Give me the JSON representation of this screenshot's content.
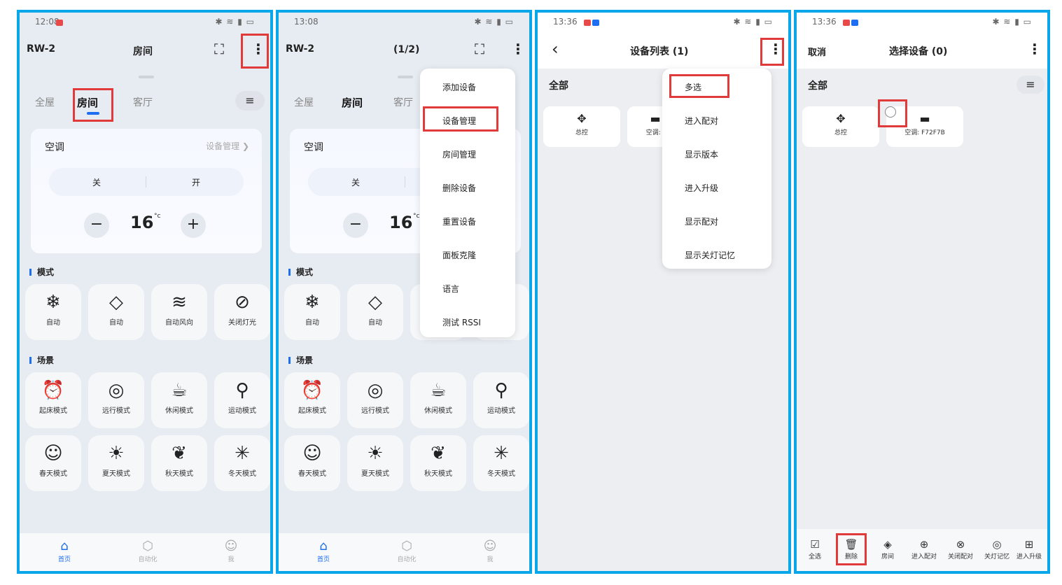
{
  "p1": {
    "status_time": "12:08",
    "status_right": "✱ ≋ ▮ ▭",
    "device": "RW-2",
    "title": "房间",
    "tabs": [
      "全屋",
      "房间",
      "客厅"
    ],
    "card": {
      "name": "空调",
      "link": "设备管理",
      "off": "关",
      "on": "开",
      "temp": "16",
      "unit": "°c"
    },
    "section_mode": "模式",
    "modes": [
      {
        "icon": "❄",
        "label": "自动"
      },
      {
        "icon": "◇",
        "label": "自动"
      },
      {
        "icon": "≋",
        "label": "自动风向"
      },
      {
        "icon": "⊘",
        "label": "关闭灯光"
      }
    ],
    "section_scene": "场景",
    "scenes": [
      {
        "icon": "⏰",
        "label": "起床模式"
      },
      {
        "icon": "◎",
        "label": "远行模式"
      },
      {
        "icon": "☕",
        "label": "休闲模式"
      },
      {
        "icon": "⚲",
        "label": "运动模式"
      },
      {
        "icon": "☺",
        "label": "春天模式"
      },
      {
        "icon": "☀",
        "label": "夏天模式"
      },
      {
        "icon": "❦",
        "label": "秋天模式"
      },
      {
        "icon": "✳",
        "label": "冬天模式"
      }
    ],
    "nav": [
      {
        "icon": "⌂",
        "label": "首页"
      },
      {
        "icon": "⬡",
        "label": "自动化"
      },
      {
        "icon": "☺",
        "label": "我"
      }
    ]
  },
  "p2": {
    "status_time": "13:08",
    "status_right": "✱ ≋ ▮ ▭",
    "device": "RW-2",
    "title": "(1/2)",
    "tabs": [
      "全屋",
      "房间",
      "客厅"
    ],
    "card": {
      "name": "空调",
      "off": "关",
      "temp": "16",
      "unit": "°c"
    },
    "section_mode": "模式",
    "modes": [
      {
        "icon": "❄",
        "label": "自动"
      },
      {
        "icon": "◇",
        "label": "自动"
      }
    ],
    "section_scene": "场景",
    "scenes": [
      {
        "icon": "⏰",
        "label": "起床模式"
      },
      {
        "icon": "◎",
        "label": "远行模式"
      },
      {
        "icon": "☕",
        "label": "休闲模式"
      },
      {
        "icon": "⚲",
        "label": "运动模式"
      },
      {
        "icon": "☺",
        "label": "春天模式"
      },
      {
        "icon": "☀",
        "label": "夏天模式"
      },
      {
        "icon": "❦",
        "label": "秋天模式"
      },
      {
        "icon": "✳",
        "label": "冬天模式"
      }
    ],
    "menu": [
      "添加设备",
      "设备管理",
      "房间管理",
      "删除设备",
      "重置设备",
      "面板克隆",
      "语言",
      "测试 RSSI"
    ],
    "nav": [
      {
        "icon": "⌂",
        "label": "首页"
      },
      {
        "icon": "⬡",
        "label": "自动化"
      },
      {
        "icon": "☺",
        "label": "我"
      }
    ]
  },
  "p3": {
    "status_time": "13:36",
    "status_right": "✱ ≋ ▮ ▭",
    "title": "设备列表 (1)",
    "filter": "全部",
    "devices": [
      {
        "icon": "✥",
        "label": "总控"
      },
      {
        "icon": "▬",
        "label": "空调: I"
      }
    ],
    "menu": [
      "多选",
      "进入配对",
      "显示版本",
      "进入升级",
      "显示配对",
      "显示关灯记忆"
    ]
  },
  "p4": {
    "status_time": "13:36",
    "status_right": "✱ ≋ ▮ ▭",
    "cancel": "取消",
    "title": "选择设备 (0)",
    "filter": "全部",
    "devices": [
      {
        "icon": "✥",
        "label": "总控"
      },
      {
        "icon": "▬",
        "label": "空调: F72F7B"
      }
    ],
    "toolbar": [
      {
        "icon": "☑",
        "label": "全选"
      },
      {
        "icon": "🗑",
        "label": "删除"
      },
      {
        "icon": "◈",
        "label": "房间"
      },
      {
        "icon": "⊕",
        "label": "进入配对"
      },
      {
        "icon": "⊗",
        "label": "关闭配对"
      },
      {
        "icon": "◎",
        "label": "关灯记忆"
      },
      {
        "icon": "⊞",
        "label": "进入升级"
      }
    ]
  }
}
